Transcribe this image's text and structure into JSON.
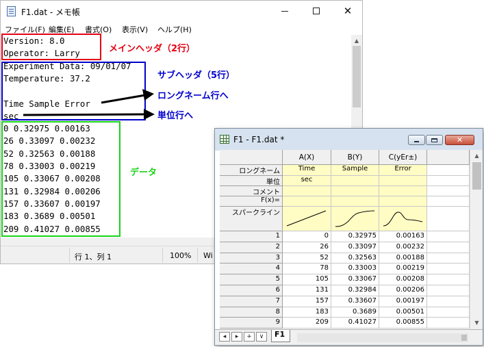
{
  "notepad": {
    "title": "F1.dat - メモ帳",
    "menu": [
      "ファイル(F)",
      "編集(E)",
      "書式(O)",
      "表示(V)",
      "ヘルプ(H)"
    ],
    "lines": [
      "Version: 8.0",
      "Operator: Larry",
      "Experiment Data: 09/01/07",
      "Temperature: 37.2",
      "",
      "Time Sample Error",
      "sec",
      "0 0.32975 0.00163",
      "26 0.33097 0.00232",
      "52 0.32563 0.00188",
      "78 0.33003 0.00219",
      "105 0.33067 0.00208",
      "131 0.32984 0.00206",
      "157 0.33607 0.00197",
      "183 0.3689 0.00501",
      "209 0.41027 0.00855"
    ],
    "status": {
      "position": "行 1、列 1",
      "zoom": "100%",
      "encoding_fragment": "Wi"
    }
  },
  "annotations": {
    "main_header": "メインヘッダ（2行）",
    "sub_header": "サブヘッダ（5行）",
    "to_long_name": "ロングネーム行へ",
    "to_unit": "単位行へ",
    "data": "データ"
  },
  "colors": {
    "main_header": "#e60012",
    "sub_header": "#0000cc",
    "data": "#17d417",
    "meta_rows": "#fffcc4"
  },
  "workbook": {
    "title": "F1 - F1.dat *",
    "columns": [
      "A(X)",
      "B(Y)",
      "C(yEr±)"
    ],
    "row_labels": {
      "long_name": "ロングネーム",
      "units": "単位",
      "comments": "コメント",
      "fx": "F(x)=",
      "sparkline": "スパークライン"
    },
    "long_names": [
      "Time",
      "Sample",
      "Error"
    ],
    "units": [
      "sec",
      "",
      ""
    ],
    "rows": [
      {
        "n": "1",
        "a": "0",
        "b": "0.32975",
        "c": "0.00163"
      },
      {
        "n": "2",
        "a": "26",
        "b": "0.33097",
        "c": "0.00232"
      },
      {
        "n": "3",
        "a": "52",
        "b": "0.32563",
        "c": "0.00188"
      },
      {
        "n": "4",
        "a": "78",
        "b": "0.33003",
        "c": "0.00219"
      },
      {
        "n": "5",
        "a": "105",
        "b": "0.33067",
        "c": "0.00208"
      },
      {
        "n": "6",
        "a": "131",
        "b": "0.32984",
        "c": "0.00206"
      },
      {
        "n": "7",
        "a": "157",
        "b": "0.33607",
        "c": "0.00197"
      },
      {
        "n": "8",
        "a": "183",
        "b": "0.3689",
        "c": "0.00501"
      },
      {
        "n": "9",
        "a": "209",
        "b": "0.41027",
        "c": "0.00855"
      }
    ],
    "sheet_tab": "F1",
    "nav": [
      "◂",
      "▸",
      "+",
      "∨"
    ]
  }
}
